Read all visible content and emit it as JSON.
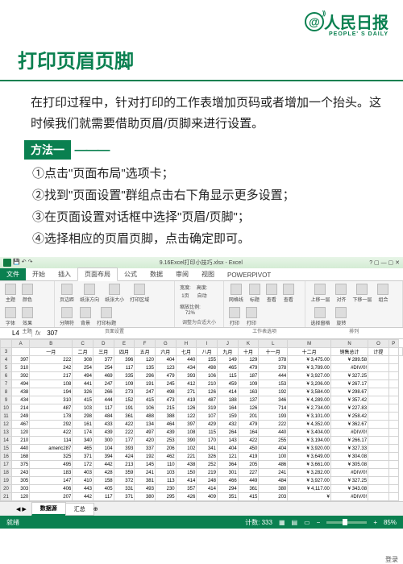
{
  "logo": {
    "main": "人民日报",
    "sub": "PEOPLE' S DAILY"
  },
  "title": "打印页眉页脚",
  "intro": "在打印过程中，针对打印的工作表增加页码或者增加一个抬头。这时候我们就需要借助页眉/页脚来进行设置。",
  "method_label": "方法一",
  "steps": {
    "s1": "①点击\"页面布局\"选项卡；",
    "s2": "②找到\"页面设置\"群组点击右下角显示更多设置；",
    "s3": "③在页面设置对话框中选择\"页眉/页脚\"；",
    "s4": "④选择相应的页眉页脚，点击确定即可。"
  },
  "excel": {
    "window_title": "9.16Excel打印小技巧.xlsx - Excel",
    "login": "登录",
    "tabs": [
      "文件",
      "开始",
      "插入",
      "页面布局",
      "公式",
      "数据",
      "审阅",
      "视图",
      "POWERPIVOT"
    ],
    "active_tab": "页面布局",
    "ribbon": {
      "g1": {
        "title": "主题",
        "items": [
          "主题",
          "颜色",
          "字体",
          "效果"
        ]
      },
      "g2": {
        "title": "页面设置",
        "items": [
          "页边距",
          "纸张方向",
          "纸张大小",
          "打印区域",
          "分隔符",
          "背景",
          "打印标题"
        ]
      },
      "g3": {
        "title": "调整为合适大小",
        "items": [
          [
            "宽度",
            "1页"
          ],
          [
            "高度",
            "自动"
          ],
          [
            "缩放比例",
            "72%"
          ]
        ]
      },
      "g4": {
        "title": "工作表选项",
        "items": [
          "网格线",
          "标题",
          "查看",
          "查看",
          "打印",
          "打印"
        ]
      },
      "g5": {
        "title": "排列",
        "items": [
          "上移一层",
          "对齐",
          "下移一层",
          "组合",
          "选择窗格",
          "旋转"
        ]
      }
    },
    "namebox": "L4",
    "formula_val": "307",
    "col_letters": [
      "",
      "A",
      "B",
      "C",
      "D",
      "E",
      "F",
      "G",
      "H",
      "I",
      "J",
      "K",
      "L",
      "M",
      "N",
      "O",
      "P"
    ],
    "first_data_row": 4,
    "headers": [
      "",
      "一月",
      "二月",
      "三月",
      "四月",
      "五月",
      "六月",
      "七月",
      "八月",
      "九月",
      "十月",
      "十一月",
      "十二月",
      "销售总计",
      "计提",
      "",
      ""
    ],
    "rows": [
      [
        "397",
        "222",
        "308",
        "377",
        "396",
        "120",
        "404",
        "440",
        "155",
        "149",
        "129",
        "378",
        "¥ 3,475.00",
        "¥ 289.58",
        "",
        ""
      ],
      [
        "310",
        "242",
        "254",
        "254",
        "117",
        "135",
        "123",
        "434",
        "498",
        "465",
        "479",
        "378",
        "¥ 3,789.00",
        "#DIV/0!",
        "",
        ""
      ],
      [
        "392",
        "217",
        "494",
        "469",
        "335",
        "296",
        "479",
        "393",
        "106",
        "115",
        "187",
        "444",
        "¥ 3,927.00",
        "¥ 327.25",
        "",
        ""
      ],
      [
        "494",
        "108",
        "441",
        "247",
        "109",
        "191",
        "245",
        "412",
        "210",
        "459",
        "109",
        "153",
        "¥ 3,206.00",
        "¥ 267.17",
        "",
        ""
      ],
      [
        "438",
        "194",
        "326",
        "266",
        "273",
        "247",
        "498",
        "271",
        "126",
        "414",
        "163",
        "192",
        "¥ 3,584.00",
        "¥ 298.67",
        "",
        ""
      ],
      [
        "434",
        "310",
        "415",
        "444",
        "152",
        "415",
        "473",
        "419",
        "487",
        "188",
        "137",
        "346",
        "¥ 4,289.00",
        "¥ 357.42",
        "",
        ""
      ],
      [
        "214",
        "487",
        "103",
        "117",
        "191",
        "106",
        "215",
        "126",
        "319",
        "164",
        "126",
        "714",
        "¥ 2,734.00",
        "¥ 227.83",
        "",
        ""
      ],
      [
        "249",
        "178",
        "298",
        "484",
        "361",
        "488",
        "388",
        "122",
        "107",
        "159",
        "201",
        "193",
        "¥ 3,101.00",
        "¥ 258.42",
        "",
        ""
      ],
      [
        "467",
        "292",
        "161",
        "433",
        "422",
        "134",
        "464",
        "397",
        "429",
        "432",
        "479",
        "222",
        "¥ 4,352.00",
        "¥ 362.67",
        "",
        ""
      ],
      [
        "120",
        "422",
        "174",
        "439",
        "222",
        "497",
        "439",
        "108",
        "115",
        "264",
        "164",
        "440",
        "¥ 3,404.00",
        "#DIV/0!",
        "",
        ""
      ],
      [
        "210",
        "114",
        "340",
        "300",
        "177",
        "420",
        "253",
        "390",
        "170",
        "143",
        "422",
        "255",
        "¥ 3,194.00",
        "¥ 266.17",
        "",
        ""
      ],
      [
        "440",
        "americ287",
        "465",
        "104",
        "393",
        "337",
        "206",
        "102",
        "341",
        "404",
        "450",
        "404",
        "¥ 3,920.00",
        "¥ 327.33",
        "",
        ""
      ],
      [
        "168",
        "325",
        "371",
        "394",
        "424",
        "192",
        "462",
        "221",
        "326",
        "121",
        "419",
        "100",
        "¥ 3,649.00",
        "¥ 304.08",
        "",
        ""
      ],
      [
        "375",
        "495",
        "172",
        "442",
        "213",
        "145",
        "110",
        "438",
        "252",
        "364",
        "205",
        "486",
        "¥ 3,661.00",
        "¥ 305.08",
        "",
        ""
      ],
      [
        "243",
        "183",
        "403",
        "428",
        "359",
        "241",
        "103",
        "150",
        "219",
        "301",
        "227",
        "241",
        "¥ 3,282.00",
        "#DIV/0!",
        "",
        ""
      ],
      [
        "305",
        "147",
        "410",
        "158",
        "372",
        "381",
        "113",
        "414",
        "248",
        "466",
        "449",
        "484",
        "¥ 3,927.00",
        "¥ 327.25",
        "",
        ""
      ],
      [
        "303",
        "406",
        "443",
        "405",
        "331",
        "493",
        "230",
        "357",
        "414",
        "294",
        "361",
        "380",
        "¥ 4,117.00",
        "¥ 343.08",
        "",
        ""
      ],
      [
        "120",
        "207",
        "442",
        "117",
        "371",
        "380",
        "295",
        "426",
        "409",
        "351",
        "415",
        "203",
        "¥",
        "#DIV/0!",
        "",
        ""
      ]
    ],
    "sheets": [
      "数据源",
      "汇总"
    ],
    "active_sheet": "数据源",
    "status": {
      "left": "就绪",
      "count": "计数: 333",
      "zoom": "85%"
    }
  }
}
